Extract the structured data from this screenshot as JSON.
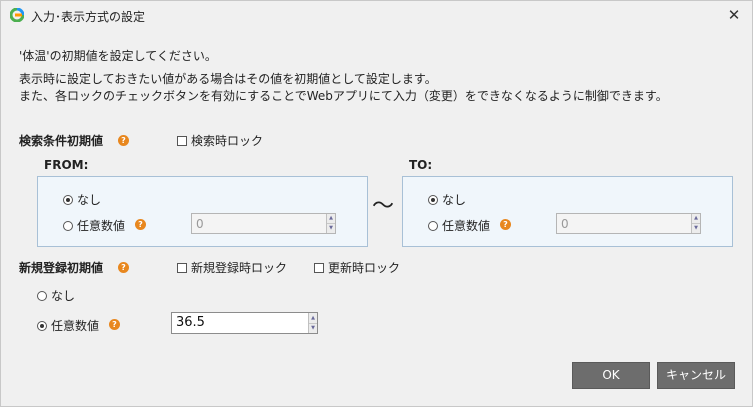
{
  "window": {
    "title": "入力･表示方式の設定",
    "app_icon": "app-logo-icon",
    "close_glyph": "✕"
  },
  "description": {
    "line1": "'体温'の初期値を設定してください。",
    "line2": "表示時に設定しておきたい値がある場合はその値を初期値として設定します。",
    "line3": "また、各ロックのチェックボタンを有効にすることでWebアプリにて入力（変更）をできなくなるように制御できます。"
  },
  "search_initial": {
    "label": "検索条件初期値",
    "lock_label": "検索時ロック",
    "lock_checked": false,
    "from": {
      "title": "FROM:",
      "option_none": "なし",
      "option_value": "任意数値",
      "selected": "none",
      "value": "0"
    },
    "separator": "〜",
    "to": {
      "title": "TO:",
      "option_none": "なし",
      "option_value": "任意数値",
      "selected": "none",
      "value": "0"
    }
  },
  "new_initial": {
    "label": "新規登録初期値",
    "new_lock_label": "新規登録時ロック",
    "new_lock_checked": false,
    "update_lock_label": "更新時ロック",
    "update_lock_checked": false,
    "option_none": "なし",
    "option_value": "任意数値",
    "selected": "value",
    "value": "36.5"
  },
  "buttons": {
    "ok": "OK",
    "cancel": "キャンセル"
  },
  "help_glyph": "?",
  "colors": {
    "help_icon": "#e8871e",
    "button_bg": "#6d6d6d",
    "panel_border": "#a8c0d6",
    "panel_bg": "#f0f6fb"
  }
}
